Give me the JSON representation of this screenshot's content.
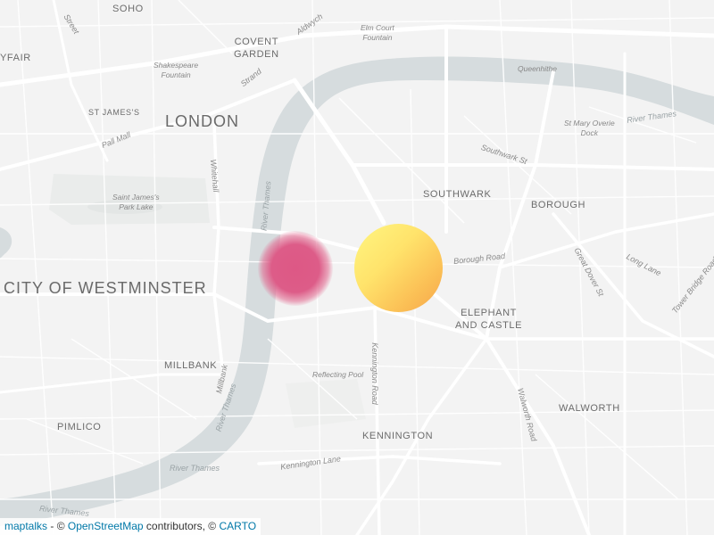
{
  "map": {
    "districts": {
      "soho": "SOHO",
      "mayfair": "YFAIR",
      "covent_garden": "COVENT\nGARDEN",
      "st_james": "ST JAMES'S",
      "london": "LONDON",
      "southwark": "SOUTHWARK",
      "borough": "BOROUGH",
      "westminster": "CITY OF WESTMINSTER",
      "elephant_castle": "ELEPHANT\nAND CASTLE",
      "millbank": "MILLBANK",
      "walworth": "WALWORTH",
      "pimlico": "PIMLICO",
      "kennington": "KENNINGTON"
    },
    "streets": {
      "street_top": "Street",
      "aldwych": "Aldwych",
      "strand": "Strand",
      "pall_mall": "Pall Mall",
      "whitehall": "Whitehall",
      "southwark_st": "Southwark St",
      "borough_road": "Borough Road",
      "great_dover_st": "Great Dover St",
      "long_lane": "Long Lane",
      "tower_bridge_rd": "Tower Bridge Road",
      "kennington_road": "Kennington Road",
      "walworth_road": "Walworth Road",
      "kennington_lane": "Kennington Lane",
      "millbank_road": "Millbank"
    },
    "pois": {
      "elm_court": "Elm Court\nFountain",
      "shakespeare": "Shakespeare\nFountain",
      "queenhithe": "Queenhithe",
      "st_mary_overie": "St Mary Overie\nDock",
      "st_james_park_lake": "Saint James's\nPark Lake",
      "reflecting_pool": "Reflecting Pool"
    },
    "water": {
      "thames_east": "River Thames",
      "thames_north": "River Thames",
      "thames_mid": "River Thames",
      "thames_south": "River Thames",
      "thames_sw": "River Thames"
    },
    "markers": [
      {
        "name": "pink-heat-marker",
        "color": "#de5a86",
        "style": "blurred"
      },
      {
        "name": "yellow-gradient-marker",
        "color_start": "#fff27a",
        "color_end": "#f7a94e",
        "style": "gradient"
      }
    ]
  },
  "attribution": {
    "maptalks": "maptalks",
    "sep": " - © ",
    "osm": "OpenStreetMap",
    "contrib": " contributors, © ",
    "carto": "CARTO"
  },
  "colors": {
    "land": "#f3f3f3",
    "water": "#d4dadc",
    "road": "#ffffff",
    "park": "#e9ecea"
  }
}
